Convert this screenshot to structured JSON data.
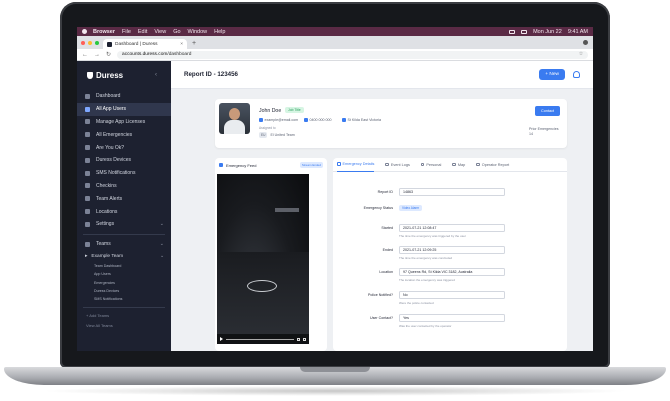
{
  "menubar": {
    "app": "Browser",
    "items": [
      "File",
      "Edit",
      "View",
      "Go",
      "Window",
      "Help"
    ],
    "datetime": "Mon Jun 22",
    "time": "9:41 AM"
  },
  "browser": {
    "tab_title": "Dashboard | Duress",
    "tab_close": "×",
    "new_tab": "+",
    "url_host": "accounts.duress.com",
    "url_path": "/dashboard",
    "nav_back": "←",
    "nav_forward": "→",
    "nav_reload": "↻",
    "star": "☆"
  },
  "sidebar": {
    "logo": "Duress",
    "collapse": "‹",
    "items": [
      {
        "label": "Dashboard"
      },
      {
        "label": "All App Users"
      },
      {
        "label": "Manage App Licenses"
      },
      {
        "label": "All Emergencies"
      },
      {
        "label": "Are You Ok?"
      },
      {
        "label": "Duress Devices"
      },
      {
        "label": "SMS Notifications"
      },
      {
        "label": "Checkins"
      },
      {
        "label": "Team Alerts"
      },
      {
        "label": "Locations"
      },
      {
        "label": "Settings"
      }
    ],
    "teams_label": "Teams",
    "team_name": "Example Team",
    "team_subitems": [
      "Team Dashboard",
      "App Users",
      "Emergencies",
      "Duress Devices",
      "SMS Notifications"
    ],
    "add_teams": "+ Add Teams",
    "view_all_teams": "View All Teams"
  },
  "header": {
    "title": "Report ID - 123456",
    "new_button": "+ New"
  },
  "profile": {
    "name": "John Doe",
    "badge": "Job Title",
    "email": "example@email.com",
    "phone": "0400 000 000",
    "address": "St Kilda East Victoria",
    "assigned_label": "Assigned to",
    "team_code": "EU",
    "team": "El United Team",
    "contact_button": "Contact",
    "prior_label": "Prior Emergencies",
    "prior_count": "14"
  },
  "feed": {
    "title": "Emergency Feed",
    "status": "Stream Ended"
  },
  "details": {
    "tabs": [
      "Emergency Details",
      "Event Logs",
      "Personal",
      "Map",
      "Operator Report"
    ],
    "fields": [
      {
        "label": "Report ID",
        "value": "14863",
        "help": ""
      },
      {
        "label": "Emergency Status",
        "badge": "Video Alarm",
        "help": ""
      },
      {
        "label": "Started",
        "value": "2021-07-21 12:08:47",
        "help": "The time the emergency was triggered by the user"
      },
      {
        "label": "Ended",
        "value": "2021-07-21 12:09:25",
        "help": "The time the emergency was concluded"
      },
      {
        "label": "Location",
        "value": "97 Queens Rd, St Kilda VIC 3182, Australia",
        "help": "The location the emergency was triggered"
      },
      {
        "label": "Police Notified?",
        "value": "No",
        "help": "Were the police contacted"
      },
      {
        "label": "User Contact?",
        "value": "Yes",
        "help": "Was the user contacted by the operator"
      }
    ]
  },
  "colors": {
    "sidebar_bg": "#1d2130",
    "accent": "#3a7bf0",
    "menubar": "#5a2a45"
  }
}
